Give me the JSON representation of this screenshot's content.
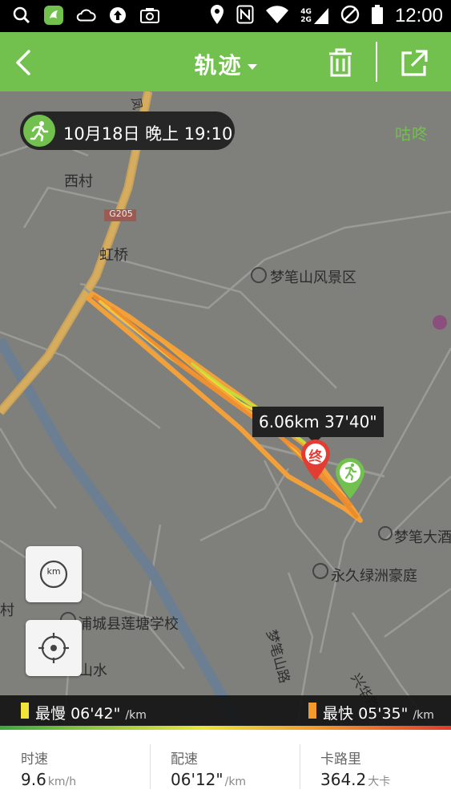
{
  "status_bar": {
    "time": "12:00",
    "network_top": "4G",
    "network_bottom": "2G",
    "icons_left": [
      "search-icon",
      "app-logo-icon",
      "cloud-icon",
      "upload-icon",
      "camera-icon"
    ],
    "icons_right": [
      "location-icon",
      "nfc-icon",
      "wifi-icon",
      "signal-icon",
      "no-disturb-icon",
      "battery-icon"
    ]
  },
  "header": {
    "title": "轨迹",
    "accent_color": "#72c04d"
  },
  "map": {
    "date_label": "10月18日 晚上 19:10",
    "brand": "咕咚",
    "tooltip": "6.06km  37'40\"",
    "end_marker": "终",
    "labels": {
      "xicun": "西村",
      "g205": "G205",
      "hongqiao": "虹桥",
      "mengbishan": "梦笔山风景区",
      "mengbi_hotel": "梦笔大酒",
      "yongjiu": "永久绿洲豪庭",
      "mengbishan_road": "梦笔山路",
      "school": "浦城县莲塘学校",
      "shanshui": "山水",
      "cun": "村",
      "xinghua_road": "兴华路",
      "vertical_road": "凤"
    },
    "km_button": "km"
  },
  "legend": {
    "slowest_label": "最慢",
    "slowest_value": "06'42\"",
    "fastest_label": "最快",
    "fastest_value": "05'35\"",
    "unit": "/km",
    "slowest_color": "#f2e33a",
    "fastest_color": "#f39a2b"
  },
  "stats": [
    {
      "label": "时速",
      "value": "9.6",
      "unit": "km/h"
    },
    {
      "label": "配速",
      "value": "06'12\"",
      "unit": "/km"
    },
    {
      "label": "卡路里",
      "value": "364.2",
      "unit": "大卡"
    }
  ]
}
